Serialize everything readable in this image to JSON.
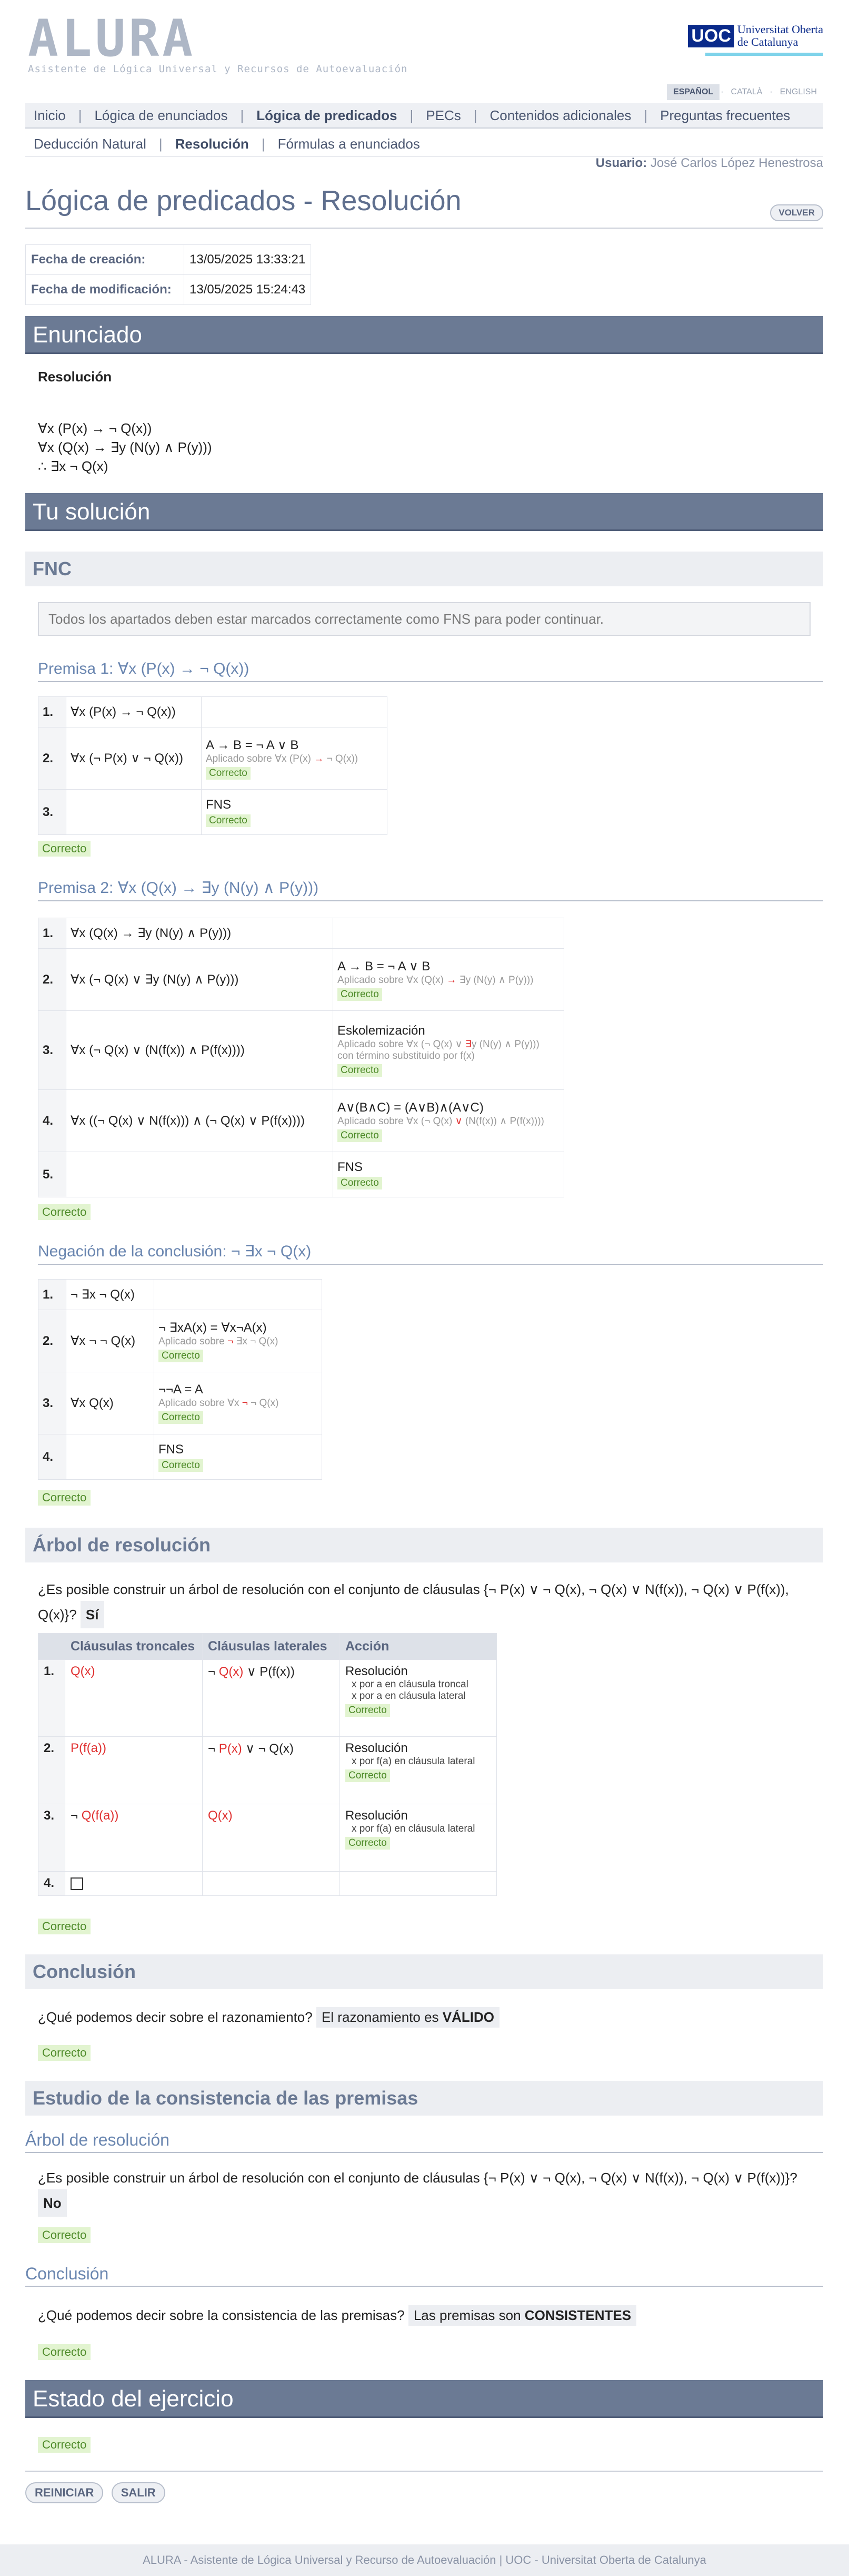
{
  "header": {
    "logo_text": "ALURA",
    "logo_sub": "Asistente de Lógica Universal y Recursos de Autoevaluación",
    "uoc_mark": "UOC",
    "uoc_name_1": "Universitat Oberta",
    "uoc_name_2": "de Catalunya",
    "languages": [
      "ESPAÑOL",
      "CATALÀ",
      "ENGLISH"
    ]
  },
  "nav": {
    "main": [
      "Inicio",
      "Lógica de enunciados",
      "Lógica de predicados",
      "PECs",
      "Contenidos adicionales",
      "Preguntas frecuentes"
    ],
    "sub": [
      "Deducción Natural",
      "Resolución",
      "Fórmulas a enunciados"
    ]
  },
  "user": {
    "label": "Usuario:",
    "name": "José Carlos López Henestrosa"
  },
  "page": {
    "title": "Lógica de predicados - Resolución",
    "back_button": "VOLVER",
    "created_label": "Fecha de creación:",
    "created_value": "13/05/2025 13:33:21",
    "modified_label": "Fecha de modificación:",
    "modified_value": "13/05/2025 15:24:43"
  },
  "enunciado": {
    "heading": "Enunciado",
    "type": "Resolución",
    "line1": "∀x (P(x) → ¬ Q(x))",
    "line2": "∀x (Q(x) → ∃y (N(y) ∧ P(y)))",
    "line3": "∴ ∃x ¬ Q(x)"
  },
  "solution": {
    "heading": "Tu solución",
    "fnc_heading": "FNC",
    "note": "Todos los apartados deben estar marcados correctamente como FNS para poder continuar.",
    "ok": "Correcto",
    "premise1": {
      "title": "Premisa 1: ∀x (P(x) → ¬ Q(x))",
      "rows": [
        {
          "n": "1.",
          "formula": "∀x (P(x) → ¬ Q(x))"
        },
        {
          "n": "2.",
          "formula": "∀x (¬ P(x) ∨ ¬ Q(x))",
          "rule": "A → B = ¬ A ∨ B",
          "applied_prefix": "Aplicado sobre ",
          "applied_a": "∀x (P(x) ",
          "applied_op": "→",
          "applied_b": " ¬ Q(x))"
        },
        {
          "n": "3.",
          "formula": "",
          "rule": "FNS"
        }
      ]
    },
    "premise2": {
      "title": "Premisa 2: ∀x (Q(x) → ∃y (N(y) ∧ P(y)))",
      "rows": [
        {
          "n": "1.",
          "formula": "∀x (Q(x) → ∃y (N(y) ∧ P(y)))"
        },
        {
          "n": "2.",
          "formula": "∀x (¬ Q(x) ∨ ∃y (N(y) ∧ P(y)))",
          "rule": "A → B = ¬ A ∨ B",
          "applied_prefix": "Aplicado sobre ",
          "applied_a": "∀x (Q(x) ",
          "applied_op": "→",
          "applied_b": " ∃y (N(y) ∧ P(y)))"
        },
        {
          "n": "3.",
          "formula": "∀x (¬ Q(x) ∨ (N(f(x)) ∧ P(f(x))))",
          "rule": "Eskolemización",
          "applied_prefix": "Aplicado sobre ",
          "applied_a": "∀x (¬ Q(x) ∨ ",
          "applied_op": "∃",
          "applied_b": "y (N(y) ∧ P(y)))",
          "extra": "con término substituido por f(x)"
        },
        {
          "n": "4.",
          "formula": "∀x ((¬ Q(x) ∨ N(f(x))) ∧ (¬ Q(x) ∨ P(f(x))))",
          "rule": "A∨(B∧C) = (A∨B)∧(A∨C)",
          "applied_prefix": "Aplicado sobre ",
          "applied_a": "∀x (¬ Q(x) ",
          "applied_op": "∨",
          "applied_b": " (N(f(x)) ∧ P(f(x))))"
        },
        {
          "n": "5.",
          "formula": "",
          "rule": "FNS"
        }
      ]
    },
    "negation": {
      "title": "Negación de la conclusión: ¬ ∃x ¬ Q(x)",
      "rows": [
        {
          "n": "1.",
          "formula": "¬ ∃x ¬ Q(x)"
        },
        {
          "n": "2.",
          "formula": "∀x ¬ ¬ Q(x)",
          "rule": "¬ ∃xA(x) = ∀x¬A(x)",
          "applied_prefix": "Aplicado sobre ",
          "applied_op": "¬",
          "applied_b": " ∃x ¬ Q(x)"
        },
        {
          "n": "3.",
          "formula": "∀x Q(x)",
          "rule": "¬¬A = A",
          "applied_prefix": "Aplicado sobre ",
          "applied_a": "∀x ",
          "applied_op": "¬",
          "applied_b": " ¬ Q(x)"
        },
        {
          "n": "4.",
          "formula": "",
          "rule": "FNS"
        }
      ]
    }
  },
  "tree": {
    "heading": "Árbol de resolución",
    "question": "¿Es posible construir un árbol de resolución con el conjunto de cláusulas {¬ P(x) ∨ ¬ Q(x), ¬ Q(x) ∨ N(f(x)), ¬ Q(x) ∨ P(f(x)), Q(x)}?",
    "answer": "Sí",
    "columns": [
      "Cláusulas troncales",
      "Cláusulas laterales",
      "Acción"
    ],
    "rows": [
      {
        "n": "1.",
        "trunk_pre": "",
        "trunk_red": "Q(x)",
        "lat_pre": "¬ ",
        "lat_red": "Q(x)",
        "lat_post": " ∨ P(f(x))",
        "action": "Resolución",
        "sub1": "x por a en cláusula troncal",
        "sub2": "x por a en cláusula lateral"
      },
      {
        "n": "2.",
        "trunk_pre": "",
        "trunk_red": "P(f(a))",
        "lat_pre": "¬ ",
        "lat_red": "P(x)",
        "lat_post": " ∨ ¬ Q(x)",
        "action": "Resolución",
        "sub1": "x por f(a) en cláusula lateral"
      },
      {
        "n": "3.",
        "trunk_pre": "¬ ",
        "trunk_red": "Q(f(a))",
        "lat_pre": "",
        "lat_red": "Q(x)",
        "lat_post": "",
        "action": "Resolución",
        "sub1": "x por f(a) en cláusula lateral"
      },
      {
        "n": "4."
      }
    ]
  },
  "conclusion": {
    "heading": "Conclusión",
    "question": "¿Qué podemos decir sobre el razonamiento?",
    "answer_pre": "El razonamiento es ",
    "answer_bold": "VÁLIDO"
  },
  "consistency": {
    "heading": "Estudio de la consistencia de las premisas",
    "tree_heading": "Árbol de resolución",
    "question": "¿Es posible construir un árbol de resolución con el conjunto de cláusulas {¬ P(x) ∨ ¬ Q(x), ¬ Q(x) ∨ N(f(x)), ¬ Q(x) ∨ P(f(x))}?",
    "answer": "No",
    "conclusion_heading": "Conclusión",
    "conclusion_question": "¿Qué podemos decir sobre la consistencia de las premisas?",
    "conclusion_answer_pre": "Las premisas son ",
    "conclusion_answer_bold": "CONSISTENTES"
  },
  "status": {
    "heading": "Estado del ejercicio",
    "value": "Correcto"
  },
  "buttons": {
    "restart": "REINICIAR",
    "exit": "SALIR"
  },
  "footer": "ALURA - Asistente de Lógica Universal y Recurso de Autoevaluación | UOC - Universitat Oberta de Catalunya",
  "colors": {
    "section_header": "#6b7a94",
    "ok_bg": "#e2f4d0",
    "ok_fg": "#4d8a28",
    "highlight": "#e03030"
  }
}
